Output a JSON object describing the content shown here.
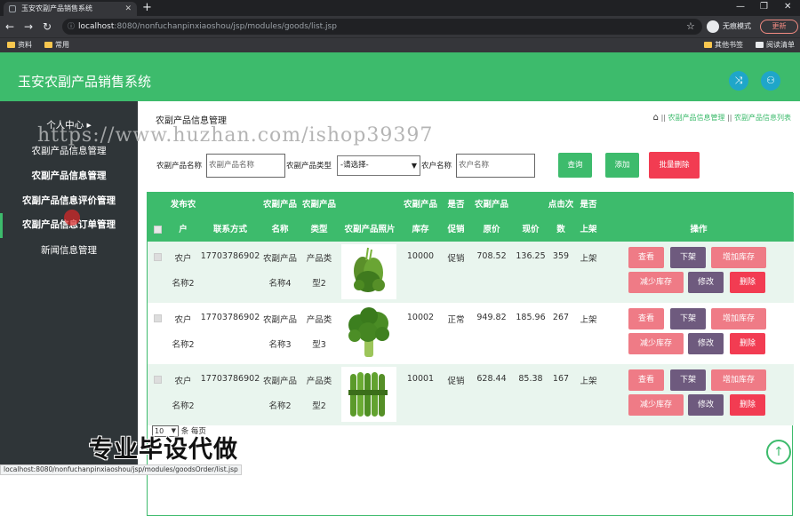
{
  "browser": {
    "tab_title": "玉安农副产品销售系统",
    "url_host": "localhost",
    "url_path": ":8080/nonfuchanpinxiaoshou/jsp/modules/goods/list.jsp",
    "incognito_label": "无痕模式",
    "update_label": "更新",
    "bookmarks": [
      "资料",
      "常用"
    ],
    "bookmarks_right": [
      "其他书签",
      "阅读清单"
    ],
    "status_url": "localhost:8080/nonfuchanpinxiaoshou/jsp/modules/goodsOrder/list.jsp"
  },
  "header": {
    "title": "玉安农副产品销售系统",
    "colors": {
      "header_bg": "#3dbb6c",
      "button_bg": "#1fa6c9"
    }
  },
  "sidebar": {
    "items": [
      {
        "label": "个人中心"
      },
      {
        "label": "农副产品信息管理"
      },
      {
        "label": "农副产品信息管理"
      },
      {
        "label": "农副产品信息评价管理"
      },
      {
        "label": "农副产品信息订单管理"
      },
      {
        "label": "新闻信息管理"
      }
    ]
  },
  "page": {
    "title": "农副产品信息管理",
    "breadcrumb": [
      "农副产品信息管理",
      "农副产品信息列表"
    ]
  },
  "search": {
    "name_label": "农副产品名称",
    "name_placeholder": "农副产品名称",
    "type_label": "农副产品类型",
    "type_selected": "-请选择-",
    "owner_label": "农户名称",
    "owner_placeholder": "农户名称",
    "query_button": "查询",
    "add_button": "添加",
    "batch_delete_button": "批量删除"
  },
  "table": {
    "headers": {
      "publisher": [
        "发布农",
        "户"
      ],
      "contact": "联系方式",
      "name": [
        "农副产品",
        "名称"
      ],
      "type": [
        "农副产品",
        "类型"
      ],
      "image": "农副产品照片",
      "stock": [
        "农副产品",
        "库存"
      ],
      "promo": [
        "是否",
        "促销"
      ],
      "orig_price": [
        "农副产品",
        "原价"
      ],
      "price": "现价",
      "clicks": [
        "点击次",
        "数"
      ],
      "listed": [
        "是否",
        "上架"
      ],
      "actions": "操作"
    },
    "rows": [
      {
        "publisher": [
          "农户",
          "名称2"
        ],
        "contact": "17703786902",
        "name": [
          "农副产品",
          "名称4"
        ],
        "type": [
          "产品类",
          "型2"
        ],
        "image": "green-vegetable-bunch",
        "stock": "10000",
        "promo": "促销",
        "orig_price": "708.52",
        "price": "136.25",
        "clicks": "359",
        "listed": "上架",
        "toggle": "下架"
      },
      {
        "publisher": [
          "农户",
          "名称2"
        ],
        "contact": "17703786902",
        "name": [
          "农副产品",
          "名称3"
        ],
        "type": [
          "产品类",
          "型3"
        ],
        "image": "broccoli",
        "stock": "10002",
        "promo": "正常",
        "orig_price": "949.82",
        "price": "185.96",
        "clicks": "267",
        "listed": "上架",
        "toggle": "下架"
      },
      {
        "publisher": [
          "农户",
          "名称2"
        ],
        "contact": "17703786902",
        "name": [
          "农副产品",
          "名称2"
        ],
        "type": [
          "产品类",
          "型2"
        ],
        "image": "green-beans",
        "stock": "10001",
        "promo": "促销",
        "orig_price": "628.44",
        "price": "85.38",
        "clicks": "167",
        "listed": "上架",
        "toggle": "下架"
      }
    ],
    "actions": {
      "view": "查看",
      "add_stock": "增加库存",
      "reduce_stock": "减少库存",
      "edit": "修改",
      "delete": "删除"
    }
  },
  "pager": {
    "page_size": "10",
    "suffix": "条 每页"
  },
  "overlay": {
    "watermark": "https://www.huzhan.com/ishop39397",
    "stamp": "专业毕设代做"
  }
}
